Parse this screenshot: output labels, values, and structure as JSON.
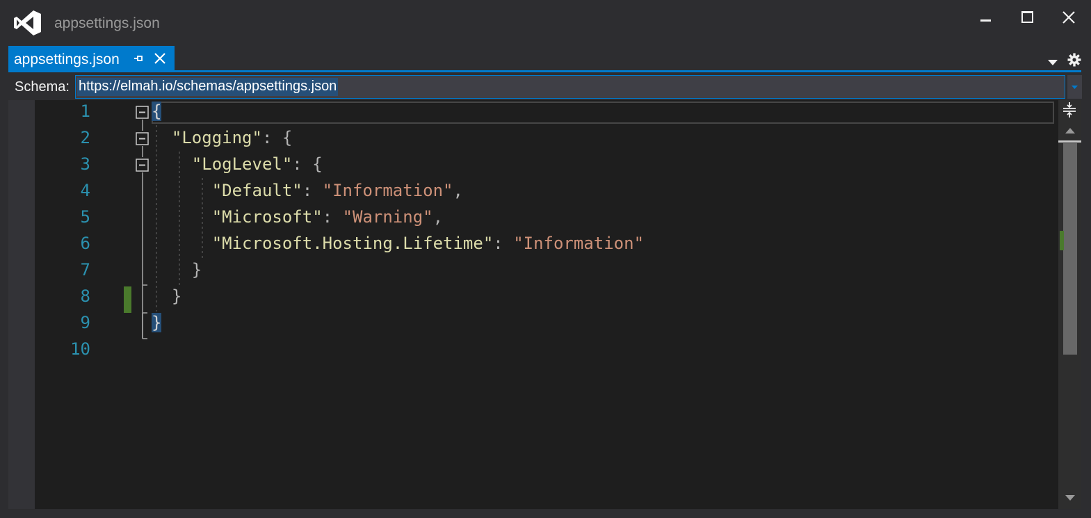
{
  "window": {
    "title": "appsettings.json",
    "logo_icon": "visual-studio-logo-icon",
    "controls": [
      "minimize-icon",
      "maximize-icon",
      "close-icon"
    ]
  },
  "tab": {
    "label": "appsettings.json",
    "pin_icon": "pin-icon",
    "close_icon": "close-icon"
  },
  "schema": {
    "label": "Schema:",
    "value": "https://elmah.io/schemas/appsettings.json"
  },
  "editor": {
    "line_numbers": [
      "1",
      "2",
      "3",
      "4",
      "5",
      "6",
      "7",
      "8",
      "9",
      "10"
    ],
    "lines": [
      {
        "indent": "",
        "key": "",
        "value": "",
        "text": "{"
      },
      {
        "indent": "  ",
        "key": "\"Logging\"",
        "value": "",
        "text": ": {"
      },
      {
        "indent": "    ",
        "key": "\"LogLevel\"",
        "value": "",
        "text": ": {"
      },
      {
        "indent": "      ",
        "key": "\"Default\"",
        "value": "\"Information\"",
        "text": ","
      },
      {
        "indent": "      ",
        "key": "\"Microsoft\"",
        "value": "\"Warning\"",
        "text": ","
      },
      {
        "indent": "      ",
        "key": "\"Microsoft.Hosting.Lifetime\"",
        "value": "\"Information\"",
        "text": ""
      },
      {
        "indent": "    ",
        "key": "",
        "value": "",
        "text": "}"
      },
      {
        "indent": "  ",
        "key": "",
        "value": "",
        "text": "}"
      },
      {
        "indent": "",
        "key": "",
        "value": "",
        "text": "}"
      },
      {
        "indent": "",
        "key": "",
        "value": "",
        "text": ""
      }
    ]
  },
  "colors": {
    "accent": "#007acc",
    "line_number": "#2b91af",
    "json_key": "#dcdcaa",
    "json_string": "#ce9178",
    "change_marker": "#4a7a2c"
  }
}
